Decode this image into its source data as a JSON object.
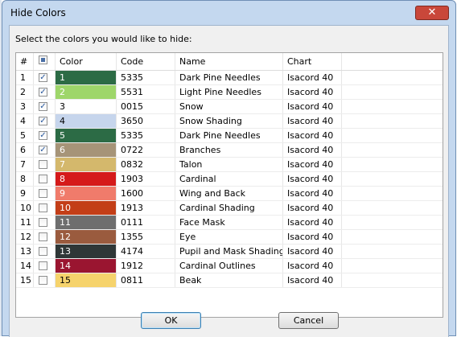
{
  "dialog": {
    "title": "Hide Colors",
    "close_label": "✕",
    "instruction": "Select the colors you would like to hide:",
    "ok_label": "OK",
    "cancel_label": "Cancel"
  },
  "table": {
    "columns": [
      "#",
      "",
      "Color",
      "Code",
      "Name",
      "Chart"
    ],
    "rows": [
      {
        "num": "1",
        "checked": true,
        "color_label": "1",
        "color_hex": "#2c6b45",
        "code": "5335",
        "name": "Dark Pine Needles",
        "chart": "Isacord 40"
      },
      {
        "num": "2",
        "checked": true,
        "color_label": "2",
        "color_hex": "#9ed66a",
        "code": "5531",
        "name": "Light Pine Needles",
        "chart": "Isacord 40"
      },
      {
        "num": "3",
        "checked": true,
        "color_label": "3",
        "color_hex": "#ffffff",
        "code": "0015",
        "name": "Snow",
        "chart": "Isacord 40"
      },
      {
        "num": "4",
        "checked": true,
        "color_label": "4",
        "color_hex": "#c6d5ec",
        "code": "3650",
        "name": "Snow Shading",
        "chart": "Isacord 40"
      },
      {
        "num": "5",
        "checked": true,
        "color_label": "5",
        "color_hex": "#2c6b45",
        "code": "5335",
        "name": "Dark Pine Needles",
        "chart": "Isacord 40"
      },
      {
        "num": "6",
        "checked": true,
        "color_label": "6",
        "color_hex": "#a69478",
        "code": "0722",
        "name": "Branches",
        "chart": "Isacord 40"
      },
      {
        "num": "7",
        "checked": false,
        "color_label": "7",
        "color_hex": "#d4b86c",
        "code": "0832",
        "name": "Talon",
        "chart": "Isacord 40"
      },
      {
        "num": "8",
        "checked": false,
        "color_label": "8",
        "color_hex": "#d51a1a",
        "code": "1903",
        "name": "Cardinal",
        "chart": "Isacord 40"
      },
      {
        "num": "9",
        "checked": false,
        "color_label": "9",
        "color_hex": "#f07b6b",
        "code": "1600",
        "name": "Wing and Back",
        "chart": "Isacord 40"
      },
      {
        "num": "10",
        "checked": false,
        "color_label": "10",
        "color_hex": "#c33e17",
        "code": "1913",
        "name": "Cardinal Shading",
        "chart": "Isacord 40"
      },
      {
        "num": "11",
        "checked": false,
        "color_label": "11",
        "color_hex": "#6e6e6e",
        "code": "0111",
        "name": "Face Mask",
        "chart": "Isacord 40"
      },
      {
        "num": "12",
        "checked": false,
        "color_label": "12",
        "color_hex": "#9a5b3e",
        "code": "1355",
        "name": "Eye",
        "chart": "Isacord 40"
      },
      {
        "num": "13",
        "checked": false,
        "color_label": "13",
        "color_hex": "#2f3737",
        "code": "4174",
        "name": "Pupil and Mask Shading",
        "chart": "Isacord 40"
      },
      {
        "num": "14",
        "checked": false,
        "color_label": "14",
        "color_hex": "#9a1530",
        "code": "1912",
        "name": "Cardinal Outlines",
        "chart": "Isacord 40"
      },
      {
        "num": "15",
        "checked": false,
        "color_label": "15",
        "color_hex": "#f6d36c",
        "code": "0811",
        "name": "Beak",
        "chart": "Isacord 40"
      }
    ]
  }
}
